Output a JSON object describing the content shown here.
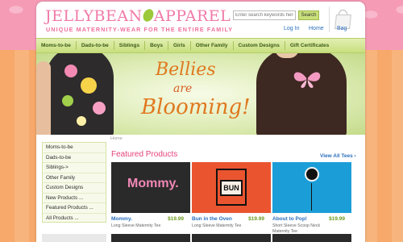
{
  "header": {
    "logo_text": "JELLYBEAN APPAREL",
    "logo_left": "JELLYBEAN",
    "logo_right": "APPAREL",
    "tagline": "UNIQUE MATERNITY-WEAR FOR THE ENTIRE FAMILY",
    "search_placeholder": "Enter search keywords here",
    "search_button": "Search",
    "login": "Log In",
    "home": "Home",
    "bag": "Bag"
  },
  "nav": {
    "items": [
      "Moms-to-be",
      "Dads-to-be",
      "Siblings",
      "Boys",
      "Girls",
      "Other Family",
      "Custom Designs",
      "Gift Certificates"
    ]
  },
  "hero": {
    "line1": "Bellies",
    "line2": "are",
    "line3": "Blooming!"
  },
  "breadcrumb": "Home",
  "sidebar": {
    "items": [
      "Moms-to-be",
      "Dads-to-be",
      "Siblings->",
      "Other Family",
      "Custom Designs",
      "New Products ...",
      "Featured Products ...",
      "All Products ..."
    ]
  },
  "featured": {
    "title": "Featured Products",
    "view_all": "View All Tees",
    "products": [
      {
        "name": "Mommy.",
        "price": "$19.99",
        "desc": "Long Sleeve Maternity Tee",
        "img_text": "Mommy."
      },
      {
        "name": "Bun in the Oven",
        "price": "$19.99",
        "desc": "Long Sleeve Maternity Tee",
        "img_text": "BUN"
      },
      {
        "name": "About to Pop!",
        "price": "$19.99",
        "desc": "Short Sleeve Scoop Neck Maternity Tee",
        "img_text": ""
      }
    ]
  },
  "colors": {
    "brand_pink": "#f07aa8",
    "nav_green": "#c8df7e",
    "link_blue": "#2a6fbe",
    "price_green": "#6d9a1f",
    "hero_orange": "#e0781f"
  }
}
